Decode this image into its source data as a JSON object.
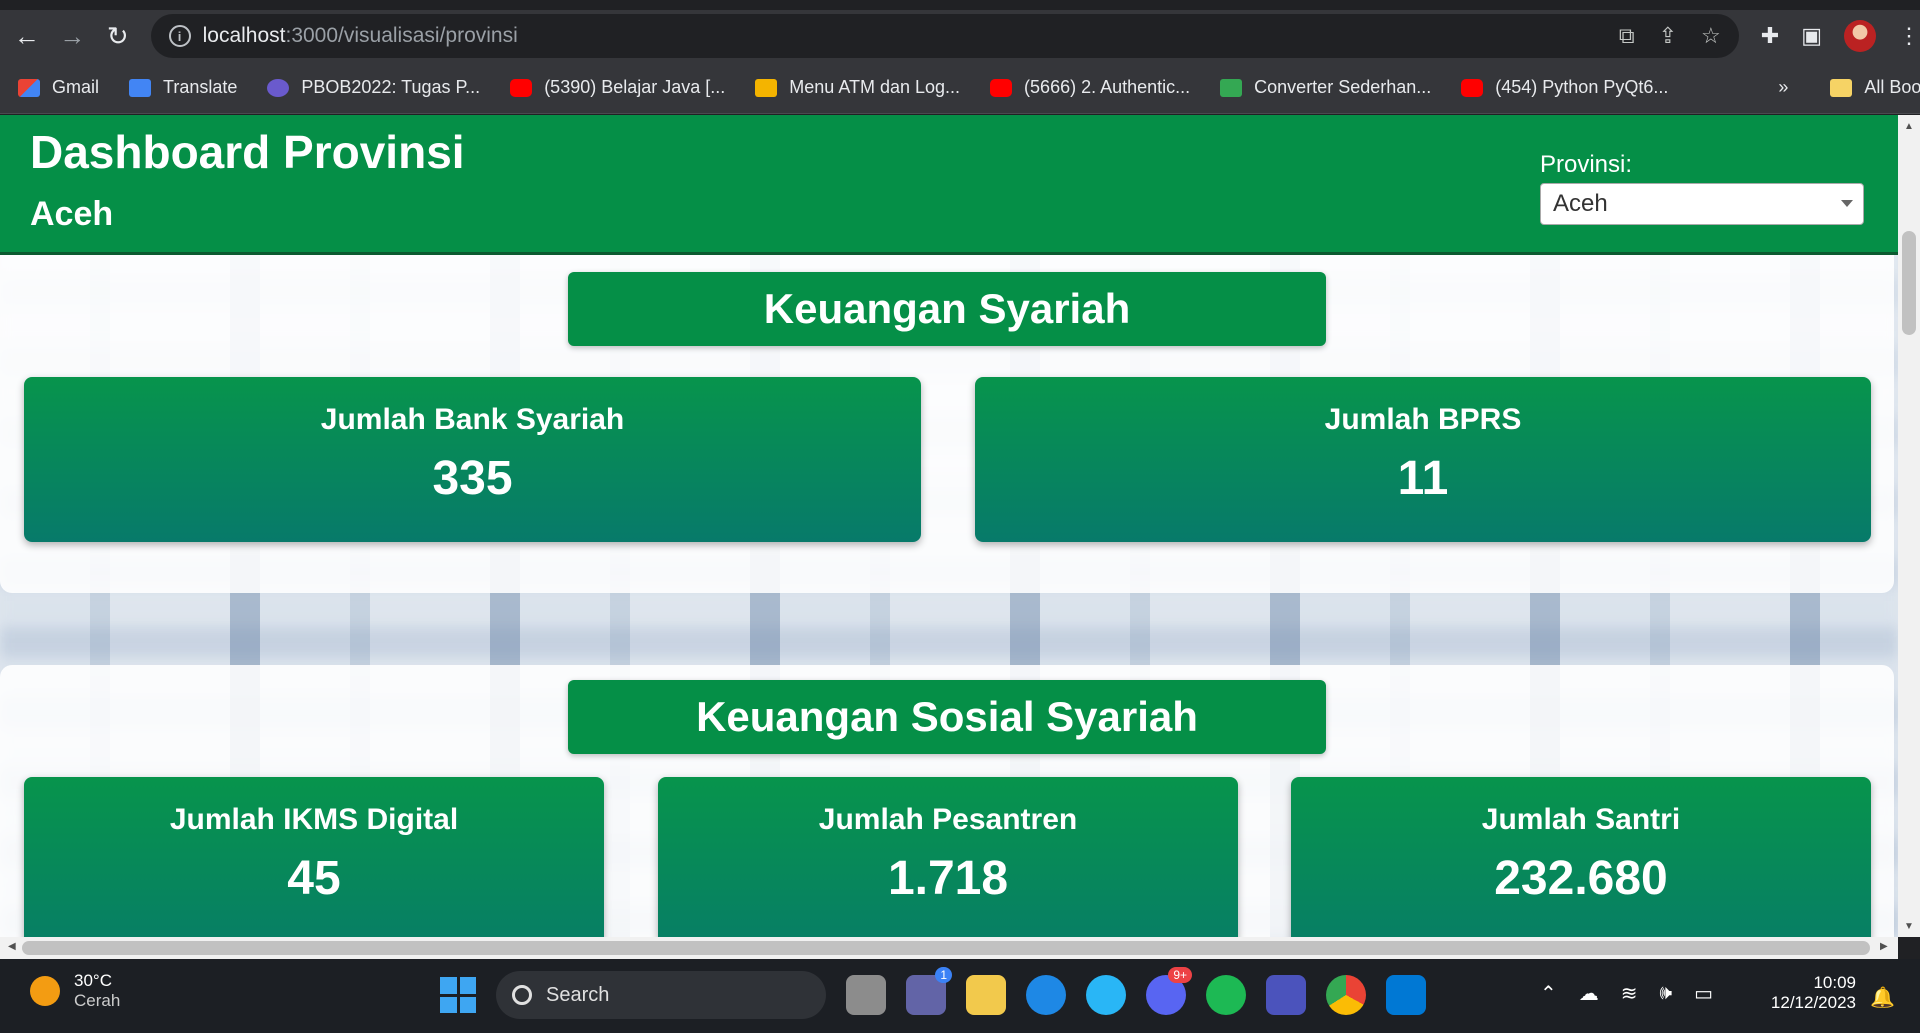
{
  "browser": {
    "url_host": "localhost",
    "url_path": ":3000/visualisasi/provinsi",
    "bookmarks": [
      {
        "label": "Gmail",
        "icon": "gmail"
      },
      {
        "label": "Translate",
        "icon": "translate"
      },
      {
        "label": "PBOB2022: Tugas P...",
        "icon": "pbob"
      },
      {
        "label": "(5390) Belajar Java [...",
        "icon": "yt"
      },
      {
        "label": "Menu ATM dan Log...",
        "icon": "box"
      },
      {
        "label": "(5666) 2. Authentic...",
        "icon": "yt"
      },
      {
        "label": "Converter Sederhan...",
        "icon": "conv"
      },
      {
        "label": "(454) Python PyQt6...",
        "icon": "yt"
      }
    ],
    "more": "»",
    "all_bookmarks": "All Bookmarks"
  },
  "header": {
    "title": "Dashboard Provinsi",
    "subtitle": "Aceh",
    "province_label": "Provinsi:",
    "province_selected": "Aceh"
  },
  "sections": [
    {
      "title": "Keuangan Syariah",
      "cards": [
        {
          "label": "Jumlah Bank Syariah",
          "value": "335"
        },
        {
          "label": "Jumlah BPRS",
          "value": "11"
        }
      ]
    },
    {
      "title": "Keuangan Sosial Syariah",
      "cards": [
        {
          "label": "Jumlah IKMS Digital",
          "value": "45"
        },
        {
          "label": "Jumlah Pesantren",
          "value": "1.718"
        },
        {
          "label": "Jumlah Santri",
          "value": "232.680"
        }
      ]
    }
  ],
  "taskbar": {
    "temp": "30°C",
    "weather": "Cerah",
    "search": "Search",
    "teams_badge": "1",
    "discord_badge": "9+",
    "time": "10:09",
    "date": "12/12/2023"
  },
  "colors": {
    "brand_green": "#058f47",
    "card_gradient_bottom": "#077a6a"
  }
}
